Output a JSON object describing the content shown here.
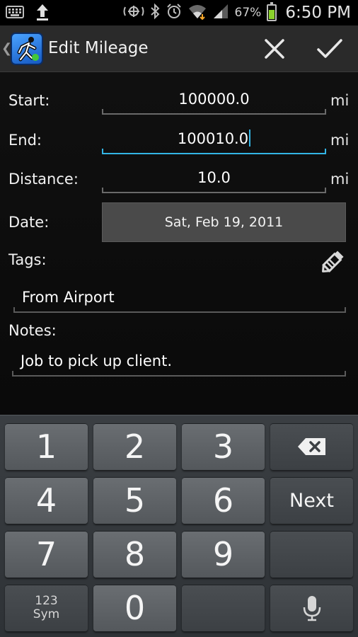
{
  "status_bar": {
    "battery_percent": "67%",
    "battery_level": 0.67,
    "time": "6:50 PM",
    "icons": [
      "keyboard-icon",
      "upload-icon",
      "nfc-icon",
      "bluetooth-icon",
      "alarm-icon",
      "wifi-icon",
      "signal-icon"
    ]
  },
  "action_bar": {
    "title": "Edit Mileage",
    "cancel_icon": "close-icon",
    "done_icon": "checkmark-icon"
  },
  "form": {
    "start": {
      "label": "Start:",
      "value": "100000.0",
      "unit": "mi"
    },
    "end": {
      "label": "End:",
      "value": "100010.0",
      "unit": "mi"
    },
    "distance": {
      "label": "Distance:",
      "value": "10.0",
      "unit": "mi"
    },
    "date": {
      "label": "Date:",
      "value": "Sat, Feb 19, 2011"
    },
    "tags": {
      "label": "Tags:",
      "value": "From Airport",
      "edit_icon": "pencil-icon"
    },
    "notes": {
      "label": "Notes:",
      "value": "Job to pick up client."
    }
  },
  "keyboard": {
    "row1": [
      "1",
      "2",
      "3"
    ],
    "row2": [
      "4",
      "5",
      "6"
    ],
    "row3": [
      "7",
      "8",
      "9"
    ],
    "zero": "0",
    "next": "Next",
    "sym_line1": "123",
    "sym_line2": "Sym",
    "backspace_icon": "backspace-icon",
    "mic_icon": "microphone-icon"
  },
  "colors": {
    "accent": "#33b5e5",
    "battery_fill": "#8bd22c",
    "action_bar": "#2a2a2a"
  }
}
